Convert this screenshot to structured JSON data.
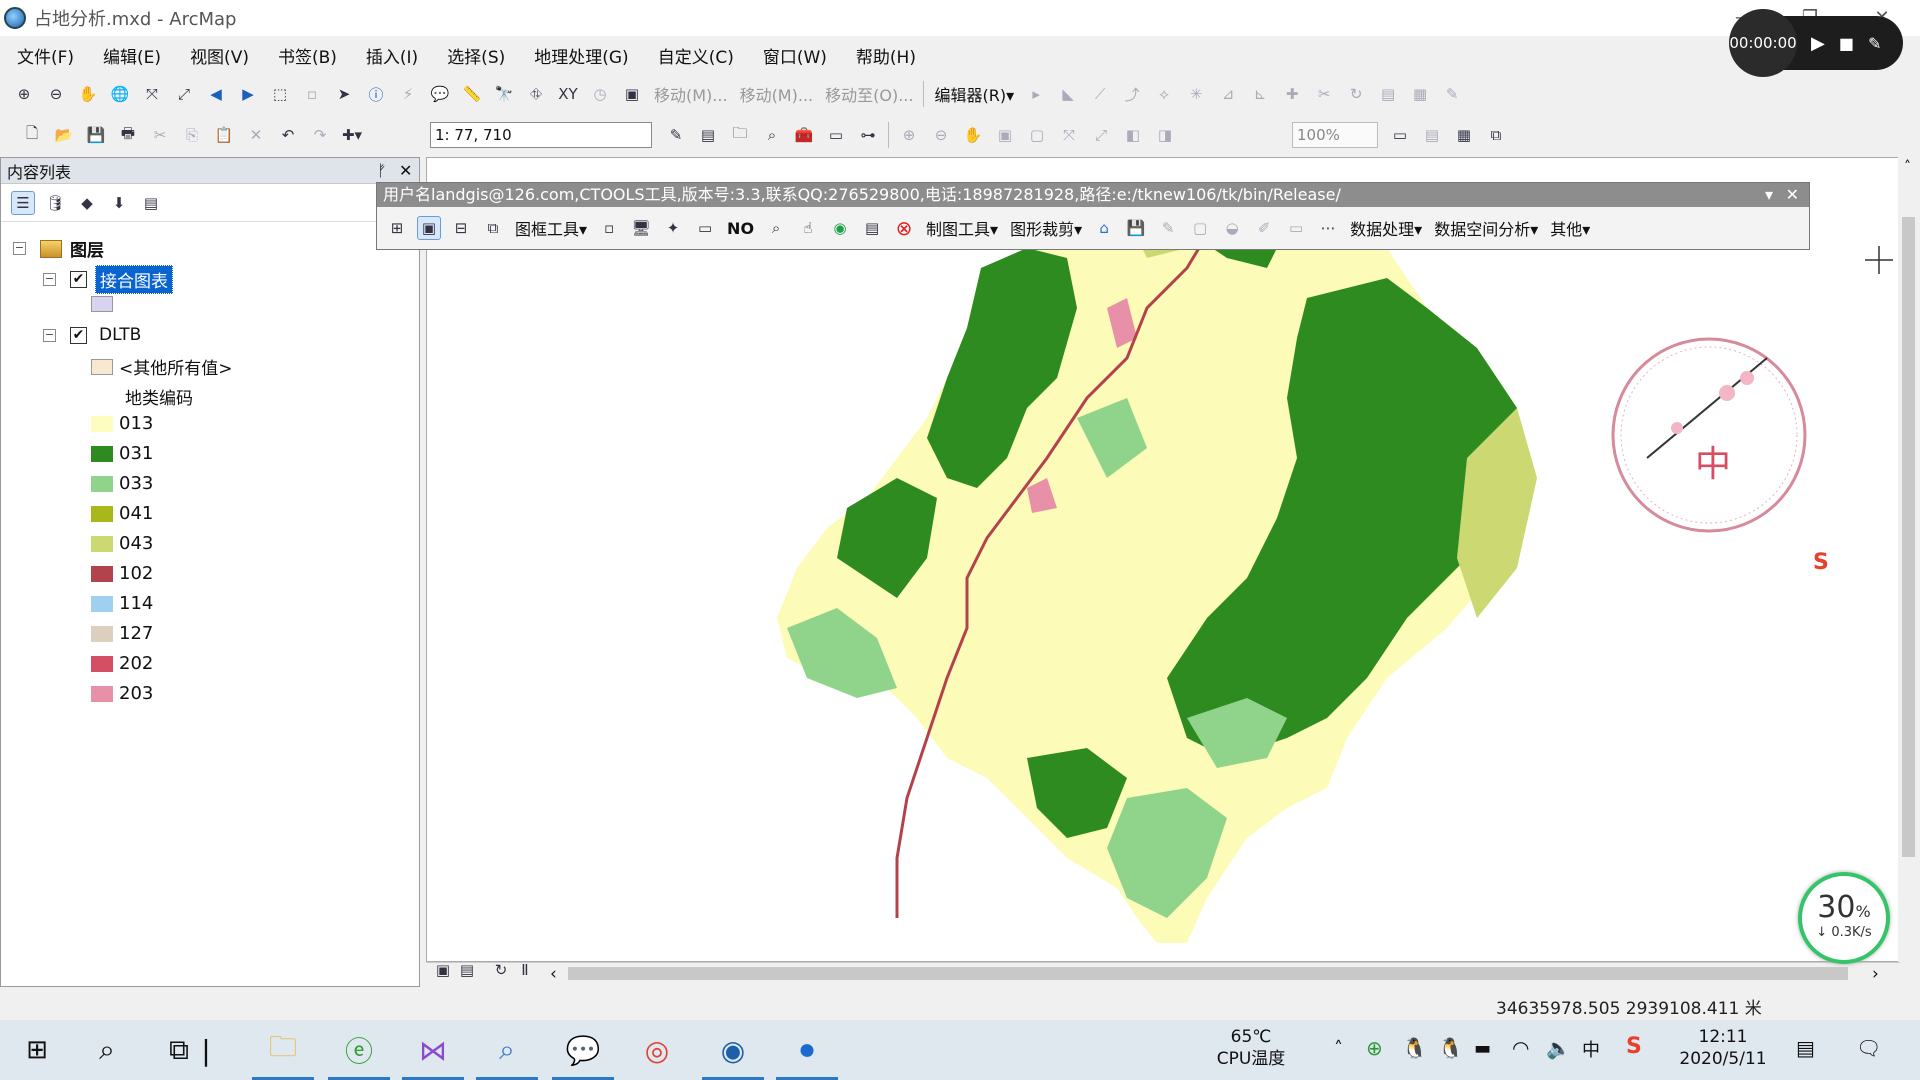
{
  "window": {
    "title": "占地分析.mxd - ArcMap",
    "minimize": "—",
    "restore": "❐",
    "close": "✕"
  },
  "menubar": [
    "文件(F)",
    "编辑(E)",
    "视图(V)",
    "书签(B)",
    "插入(I)",
    "选择(S)",
    "地理处理(G)",
    "自定义(C)",
    "窗口(W)",
    "帮助(H)"
  ],
  "toolbar1": {
    "move1": "移动(M)...",
    "move2": "移动(M)...",
    "move_to": "移动至(O)...",
    "editor": "编辑器(R)▾"
  },
  "toolbar2": {
    "scale": "1: 77, 710",
    "zoom": "100%"
  },
  "toc": {
    "header": "内容列表",
    "pin": "ᚠ",
    "close": "✕",
    "root_label": "图层",
    "layer1": "接合图表",
    "layer2": "DLTB",
    "other_values": "<其他所有值>",
    "field_name": "地类编码",
    "legend": [
      {
        "code": "013",
        "color": "#fdfdc0"
      },
      {
        "code": "031",
        "color": "#2e8b20"
      },
      {
        "code": "033",
        "color": "#8fd48a"
      },
      {
        "code": "041",
        "color": "#a8b81a"
      },
      {
        "code": "043",
        "color": "#ccd872"
      },
      {
        "code": "102",
        "color": "#b2434c"
      },
      {
        "code": "114",
        "color": "#9fd0f0"
      },
      {
        "code": "127",
        "color": "#dccfbf"
      },
      {
        "code": "202",
        "color": "#d44f64"
      },
      {
        "code": "203",
        "color": "#e890a8"
      }
    ],
    "layer1_swatch": "#d8d4f0",
    "other_swatch": "#f7e8d2"
  },
  "ctools": {
    "header": "用户名landgis@126.com,CTOOLS工具,版本号:3.3,联系QQ:276529800,电话:18987281928,路径:e:/tknew106/tk/bin/Release/",
    "frame_tools": "图框工具▾",
    "no": "NO",
    "mapping_tools": "制图工具▾",
    "clip": "图形裁剪▾",
    "data_proc": "数据处理▾",
    "spatial": "数据空间分析▾",
    "other": "其他▾"
  },
  "map": {
    "stamp_char": "中"
  },
  "status": {
    "coords": "34635978.505  2939108.411 米"
  },
  "recorder": {
    "time": "00:00:00"
  },
  "netwidget": {
    "percent": "30",
    "unit": "%",
    "speed": "↓ 0.3K/s"
  },
  "taskbar": {
    "temp": "65℃",
    "temp_label": "CPU温度",
    "time": "12:11",
    "date": "2020/5/11",
    "ime": "中"
  }
}
